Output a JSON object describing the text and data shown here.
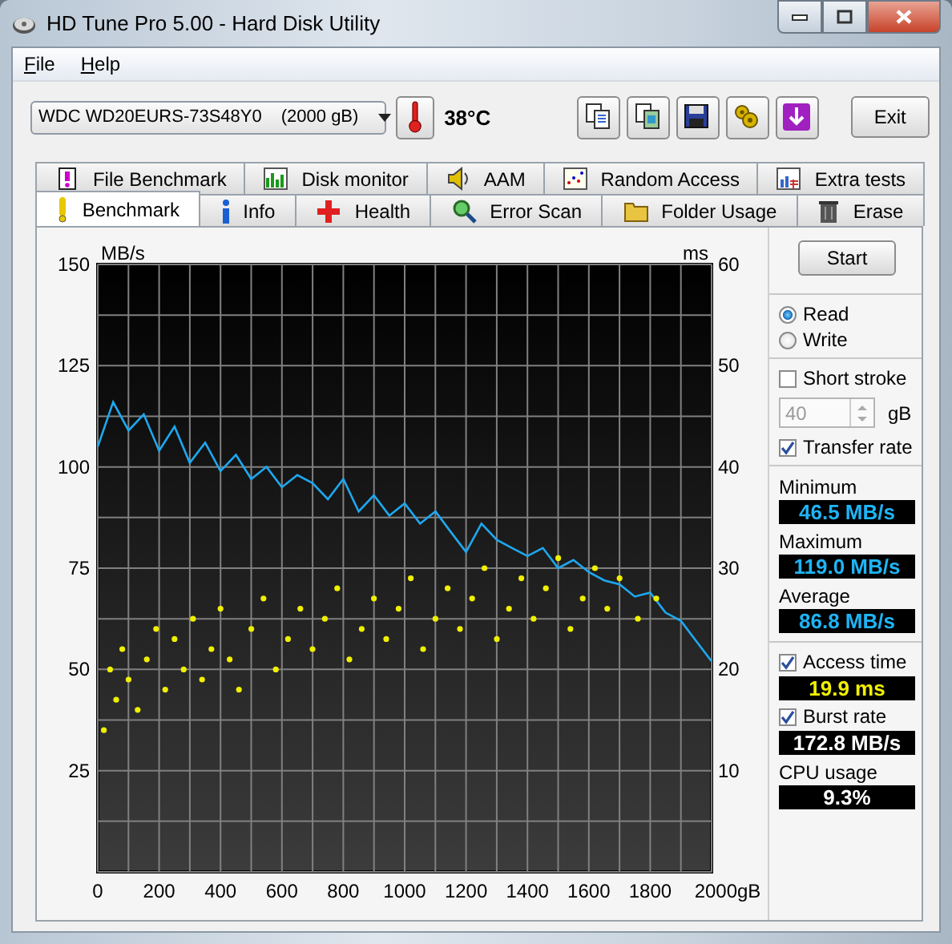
{
  "window": {
    "title": "HD Tune Pro 5.00 - Hard Disk Utility"
  },
  "menu": [
    {
      "label": "File"
    },
    {
      "label": "Help"
    }
  ],
  "toolbar": {
    "drive": {
      "name": "WDC WD20EURS-73S48Y0",
      "capacity": "(2000 gB)"
    },
    "temperature": "38°C",
    "exit": "Exit"
  },
  "tabs_back": [
    {
      "label": "File Benchmark",
      "selected": false
    },
    {
      "label": "Disk monitor",
      "selected": false
    },
    {
      "label": "AAM",
      "selected": false
    },
    {
      "label": "Random Access",
      "selected": false
    },
    {
      "label": "Extra tests",
      "selected": false
    }
  ],
  "tabs_front": [
    {
      "label": "Benchmark",
      "selected": true
    },
    {
      "label": "Info",
      "selected": false
    },
    {
      "label": "Health",
      "selected": false
    },
    {
      "label": "Error Scan",
      "selected": false
    },
    {
      "label": "Folder Usage",
      "selected": false
    },
    {
      "label": "Erase",
      "selected": false
    }
  ],
  "transfer_chart": {
    "chart_data": {
      "type": "line",
      "ylabel": "MB/s",
      "grid": true,
      "xlim": [
        0,
        2000
      ],
      "ylim": [
        0,
        150
      ],
      "xticks": [
        0,
        200,
        400,
        600,
        800,
        1000,
        1200,
        1400,
        1600,
        1800,
        {
          "value": 2000,
          "label": "2000gB"
        }
      ],
      "yticks": [
        25,
        50,
        75,
        100,
        125,
        150
      ],
      "x": [
        0,
        50,
        100,
        150,
        200,
        250,
        300,
        350,
        400,
        450,
        500,
        550,
        600,
        650,
        700,
        750,
        800,
        850,
        900,
        950,
        1000,
        1050,
        1100,
        1150,
        1200,
        1250,
        1300,
        1350,
        1400,
        1450,
        1500,
        1550,
        1600,
        1650,
        1700,
        1750,
        1800,
        1850,
        1900,
        1950,
        2000
      ],
      "series": [
        {
          "color": "#1ea8f0",
          "values": [
            105,
            116,
            109,
            113,
            104,
            110,
            101,
            106,
            99,
            103,
            97,
            100,
            95,
            98,
            96,
            92,
            97,
            89,
            93,
            88,
            91,
            86,
            89,
            84,
            79,
            86,
            82,
            80,
            78,
            80,
            75,
            77,
            74,
            72,
            71,
            68,
            69,
            64,
            62,
            57,
            52
          ]
        }
      ]
    }
  },
  "access_chart": {
    "chart_data": {
      "type": "scatter",
      "ylabel": "ms",
      "xlim": [
        0,
        2000
      ],
      "ylim": [
        0,
        60
      ],
      "yticks": [
        10,
        20,
        30,
        40,
        50,
        60
      ],
      "x": [
        20,
        40,
        60,
        80,
        100,
        130,
        160,
        190,
        220,
        250,
        280,
        310,
        340,
        370,
        400,
        430,
        460,
        500,
        540,
        580,
        620,
        660,
        700,
        740,
        780,
        820,
        860,
        900,
        940,
        980,
        1020,
        1060,
        1100,
        1140,
        1180,
        1220,
        1260,
        1300,
        1340,
        1380,
        1420,
        1460,
        1500,
        1540,
        1580,
        1620,
        1660,
        1700,
        1760,
        1820
      ],
      "series": [
        {
          "color": "#f0f000",
          "values": [
            14,
            20,
            17,
            22,
            19,
            16,
            21,
            24,
            18,
            23,
            20,
            25,
            19,
            22,
            26,
            21,
            18,
            24,
            27,
            20,
            23,
            26,
            22,
            25,
            28,
            21,
            24,
            27,
            23,
            26,
            29,
            22,
            25,
            28,
            24,
            27,
            30,
            23,
            26,
            29,
            25,
            28,
            31,
            24,
            27,
            30,
            26,
            29,
            25,
            27
          ]
        }
      ]
    }
  },
  "side": {
    "start": "Start",
    "modes": [
      {
        "label": "Read",
        "selected": true
      },
      {
        "label": "Write",
        "selected": false
      }
    ],
    "short_stroke": {
      "label": "Short stroke",
      "checked": false
    },
    "stroke_size": {
      "value": "40",
      "unit": "gB",
      "disabled": true
    },
    "transfer_rate": {
      "label": "Transfer rate",
      "checked": true
    },
    "stats": [
      {
        "label": "Minimum",
        "value": "46.5 MB/s",
        "kind": "rate"
      },
      {
        "label": "Maximum",
        "value": "119.0 MB/s",
        "kind": "rate"
      },
      {
        "label": "Average",
        "value": "86.8 MB/s",
        "kind": "rate"
      }
    ],
    "access_time": {
      "label": "Access time",
      "checked": true,
      "value": "19.9 ms",
      "kind": "time"
    },
    "burst_rate": {
      "label": "Burst rate",
      "checked": true,
      "value": "172.8 MB/s",
      "kind": "plain"
    },
    "cpu_usage": {
      "label": "CPU usage",
      "value": "9.3%",
      "kind": "plain"
    }
  }
}
